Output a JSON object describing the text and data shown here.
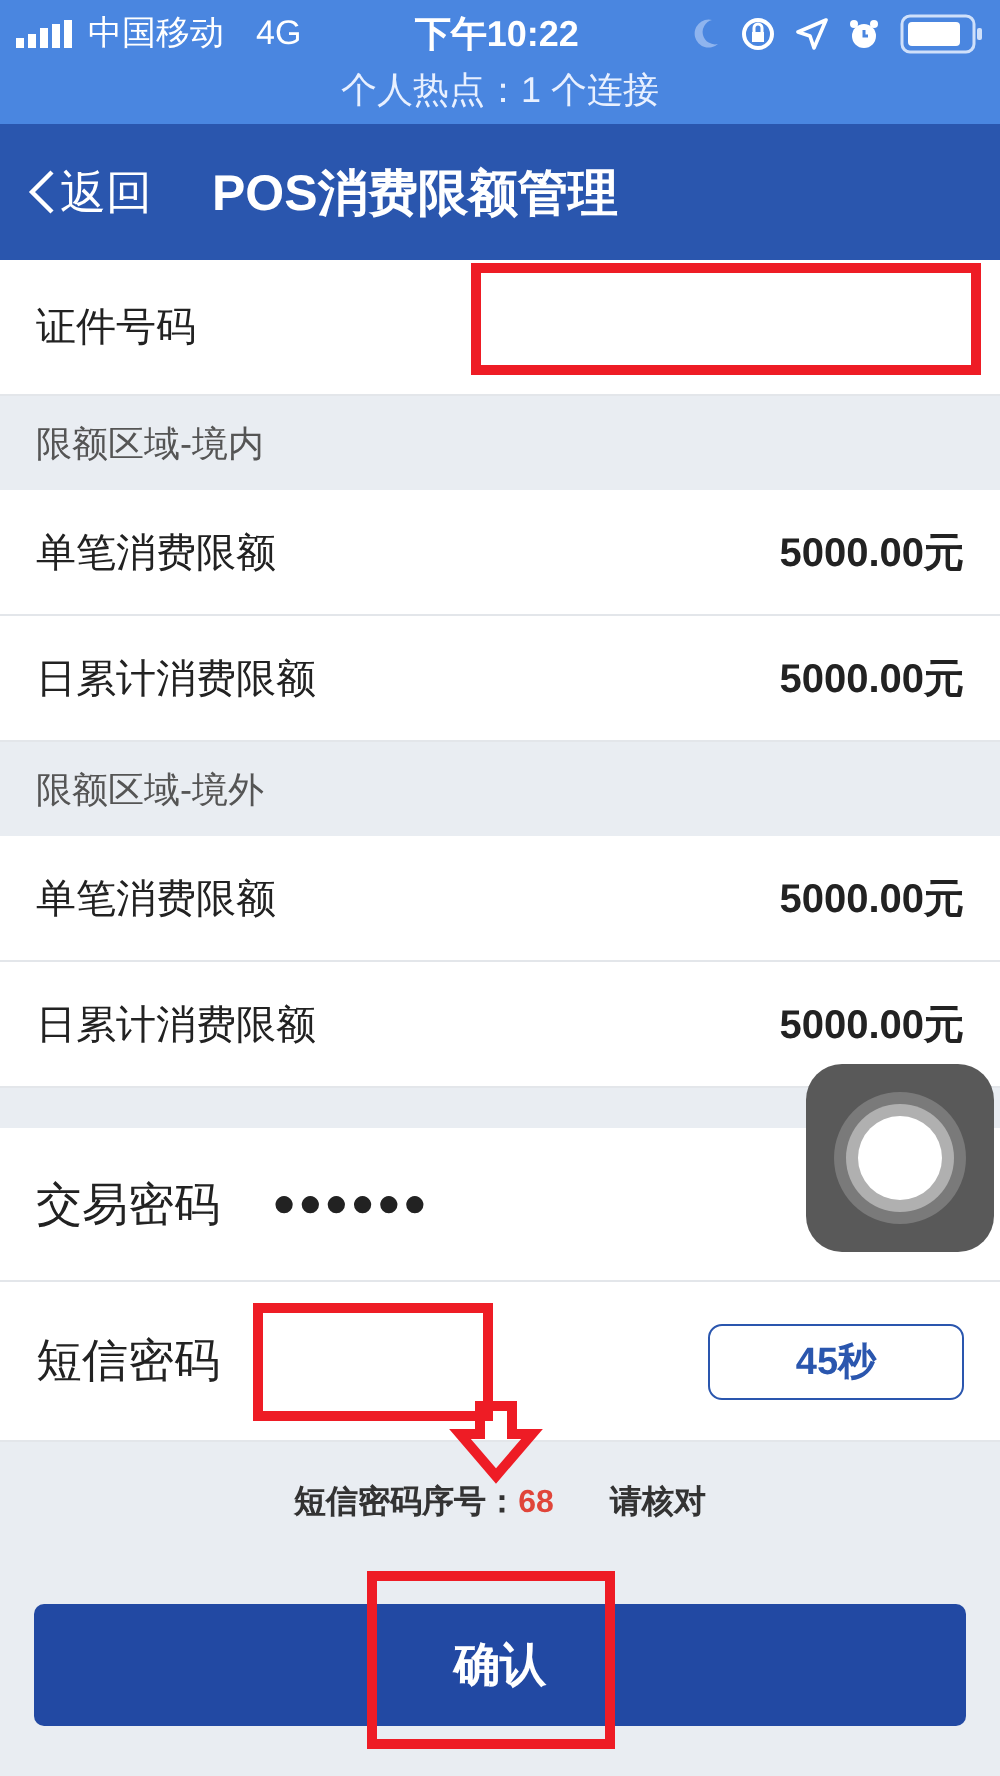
{
  "status_bar": {
    "carrier": "中国移动",
    "network": "4G",
    "time": "下午10:22",
    "hotspot": "个人热点：1 个连接"
  },
  "nav": {
    "back": "返回",
    "title": "POS消费限额管理"
  },
  "id_row": {
    "label": "证件号码"
  },
  "sections": [
    {
      "title": "限额区域-境内",
      "rows": [
        {
          "label": "单笔消费限额",
          "value": "5000.00元"
        },
        {
          "label": "日累计消费限额",
          "value": "5000.00元"
        }
      ]
    },
    {
      "title": "限额区域-境外",
      "rows": [
        {
          "label": "单笔消费限额",
          "value": "5000.00元"
        },
        {
          "label": "日累计消费限额",
          "value": "5000.00元"
        }
      ]
    }
  ],
  "password": {
    "label": "交易密码",
    "value": "●●●●●●"
  },
  "sms": {
    "label": "短信密码",
    "countdown": "45秒"
  },
  "hint": {
    "label": "短信密码序号：",
    "serial": "68",
    "note": "请核对"
  },
  "confirm": "确认"
}
